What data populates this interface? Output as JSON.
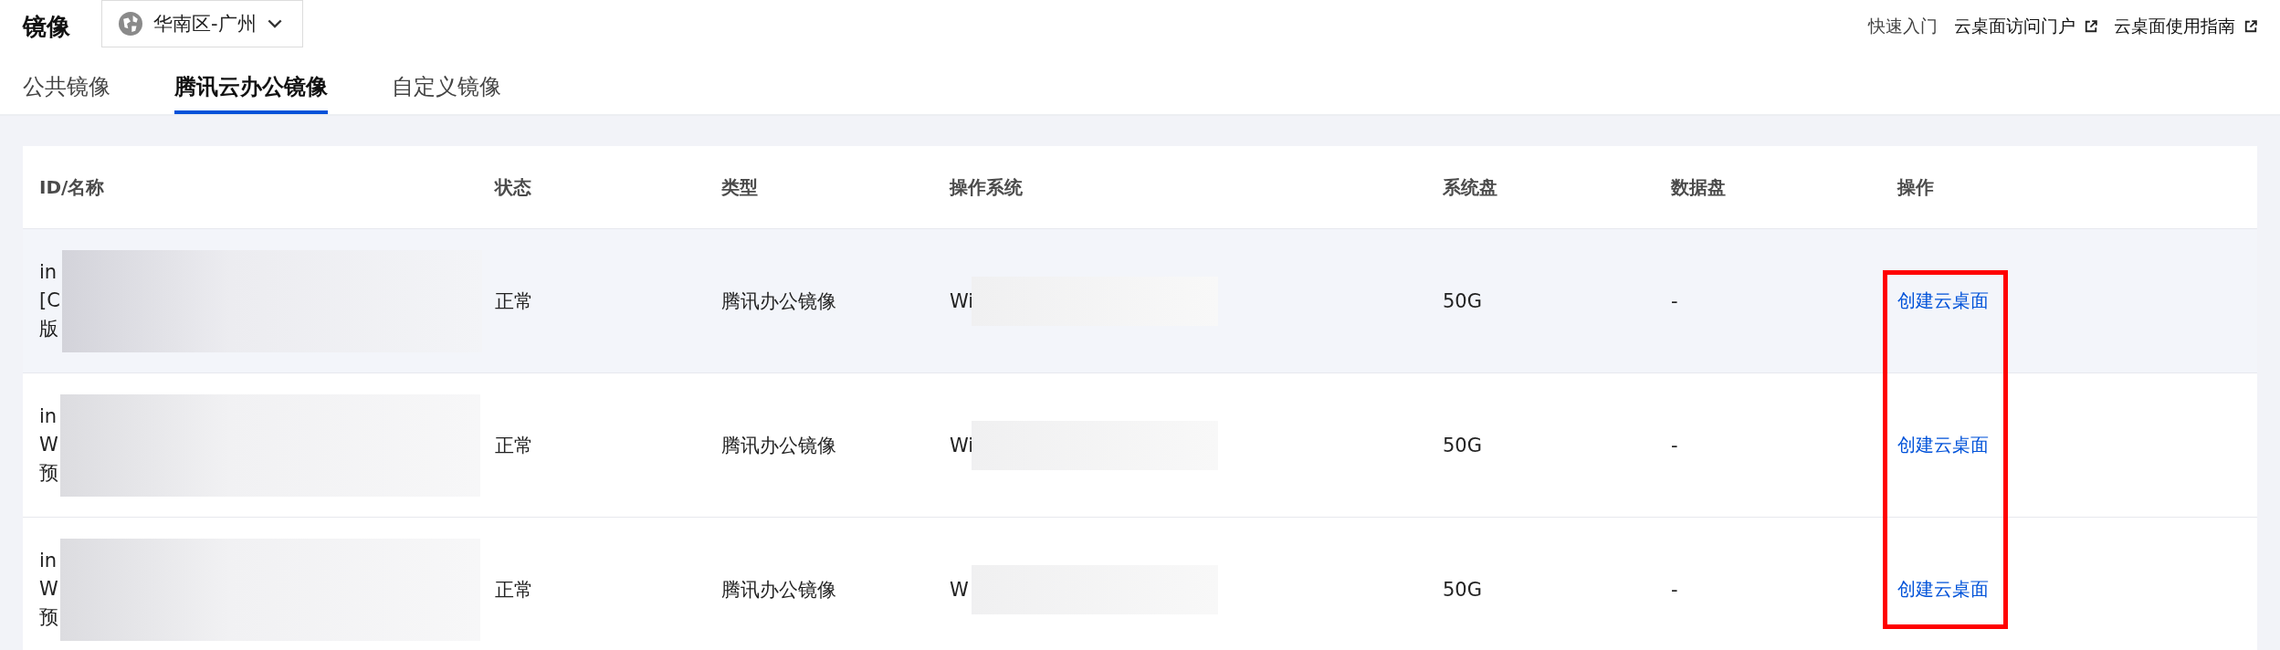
{
  "page": {
    "title": "镜像"
  },
  "region_select": {
    "value": "华南区-广州"
  },
  "header_links": [
    {
      "label": "快速入门",
      "external": false
    },
    {
      "label": "云桌面访问门户",
      "external": true
    },
    {
      "label": "云桌面使用指南",
      "external": true
    }
  ],
  "tabs": [
    {
      "label": "公共镜像",
      "selected": false
    },
    {
      "label": "腾讯云办公镜像",
      "selected": true
    },
    {
      "label": "自定义镜像",
      "selected": false
    }
  ],
  "table": {
    "columns": [
      "ID/名称",
      "状态",
      "类型",
      "操作系统",
      "系统盘",
      "数据盘",
      "操作"
    ],
    "rows": [
      {
        "id_name": [
          "in",
          "[C",
          "版"
        ],
        "status": "正常",
        "type": "腾讯办公镜像",
        "os": "Wi",
        "system_disk": "50G",
        "data_disk": "-",
        "action": "创建云桌面",
        "highlighted": true,
        "redacted": true
      },
      {
        "id_name": [
          "in",
          "W",
          "预"
        ],
        "status": "正常",
        "type": "腾讯办公镜像",
        "os": "Wi",
        "system_disk": "50G",
        "data_disk": "-",
        "action": "创建云桌面",
        "highlighted": false,
        "redacted": true
      },
      {
        "id_name": [
          "in",
          "W",
          "预"
        ],
        "status": "正常",
        "type": "腾讯办公镜像",
        "os": "W",
        "system_disk": "50G",
        "data_disk": "-",
        "action": "创建云桌面",
        "highlighted": false,
        "redacted": true
      }
    ]
  },
  "action_column_marked": true
}
